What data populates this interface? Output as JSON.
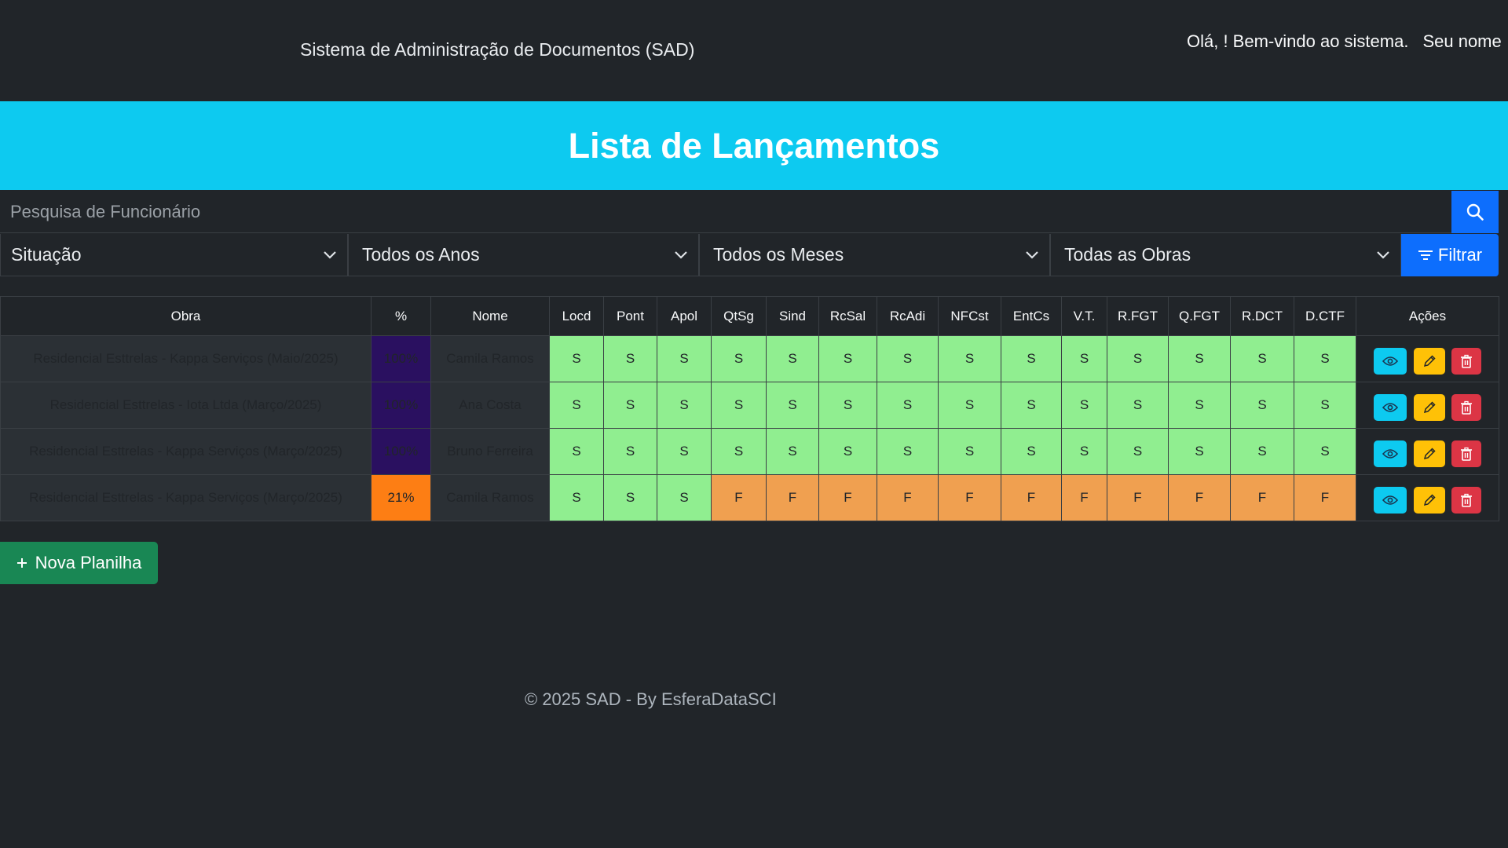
{
  "header": {
    "app_title": "Sistema de Administração de Documentos (SAD)",
    "welcome": "Olá, ! Bem-vindo ao sistema.",
    "user_name": "Seu nome"
  },
  "banner": {
    "title": "Lista de Lançamentos"
  },
  "search": {
    "placeholder": "Pesquisa de Funcionário",
    "icon": "search-icon"
  },
  "filters": {
    "situacao": "Situação",
    "ano": "Todos os Anos",
    "mes": "Todos os Meses",
    "obra": "Todas as Obras",
    "button_label": "Filtrar"
  },
  "table": {
    "headers": [
      "Obra",
      "%",
      "Nome",
      "Locd",
      "Pont",
      "Apol",
      "QtSg",
      "Sind",
      "RcSal",
      "RcAdi",
      "NFCst",
      "EntCs",
      "V.T.",
      "R.FGT",
      "Q.FGT",
      "R.DCT",
      "D.CTF",
      "Ações"
    ],
    "rows": [
      {
        "obra": "Residencial Esttrelas - Kappa Serviços (Maio/2025)",
        "pct": "100%",
        "nome": "Camila Ramos",
        "status": [
          "S",
          "S",
          "S",
          "S",
          "S",
          "S",
          "S",
          "S",
          "S",
          "S",
          "S",
          "S",
          "S",
          "S"
        ]
      },
      {
        "obra": "Residencial Esttrelas - Iota Ltda (Março/2025)",
        "pct": "100%",
        "nome": "Ana Costa",
        "status": [
          "S",
          "S",
          "S",
          "S",
          "S",
          "S",
          "S",
          "S",
          "S",
          "S",
          "S",
          "S",
          "S",
          "S"
        ]
      },
      {
        "obra": "Residencial Esttrelas - Kappa Serviços (Março/2025)",
        "pct": "100%",
        "nome": "Bruno Ferreira",
        "status": [
          "S",
          "S",
          "S",
          "S",
          "S",
          "S",
          "S",
          "S",
          "S",
          "S",
          "S",
          "S",
          "S",
          "S"
        ]
      },
      {
        "obra": "Residencial Esttrelas - Kappa Serviços (Março/2025)",
        "pct": "21%",
        "nome": "Camila Ramos",
        "status": [
          "S",
          "S",
          "S",
          "F",
          "F",
          "F",
          "F",
          "F",
          "F",
          "F",
          "F",
          "F",
          "F",
          "F"
        ]
      }
    ]
  },
  "actions": {
    "new_sheet": "Nova Planilha"
  },
  "footer": {
    "text": "© 2025 SAD - By EsferaDataSCI"
  },
  "colors": {
    "primary": "#0d6efd",
    "info": "#0dcaf0",
    "success": "#198754",
    "warning": "#ffc107",
    "danger": "#dc3545",
    "ok_cell": "#90ee90",
    "missing_cell": "#f0a050"
  }
}
